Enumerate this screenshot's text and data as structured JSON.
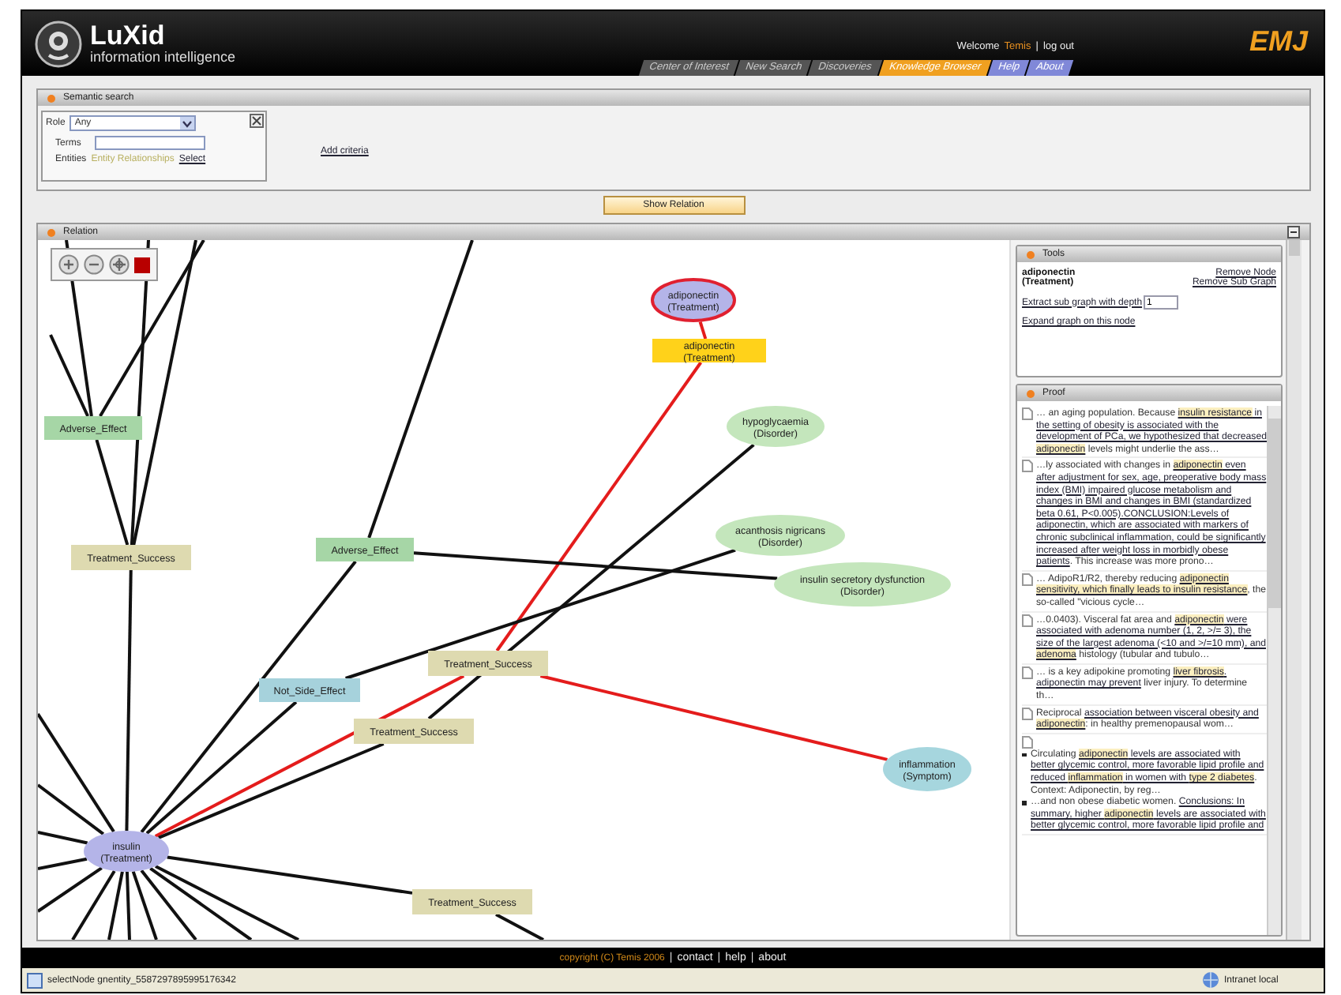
{
  "header": {
    "logo_name": "LuXid",
    "logo_tagline": "information intelligence",
    "welcome": "Welcome",
    "user": "Temis",
    "separator": "|",
    "logout": "log out",
    "brand": "EMJ"
  },
  "tabs": [
    {
      "label": "Center of Interest",
      "kind": "section",
      "selected": false
    },
    {
      "label": "New Search",
      "kind": "section",
      "selected": false
    },
    {
      "label": "Discoveries",
      "kind": "section",
      "selected": false
    },
    {
      "label": "Knowledge Browser",
      "kind": "section",
      "selected": true
    },
    {
      "label": "Help",
      "kind": "info",
      "selected": false
    },
    {
      "label": "About",
      "kind": "info",
      "selected": false
    }
  ],
  "semantic_search": {
    "title": "Semantic search",
    "role_label": "Role",
    "role_value": "Any",
    "terms_label": "Terms",
    "entities_label": "Entities",
    "entities_value": "Entity Relationships",
    "select_link": "Select",
    "add_criteria": "Add criteria"
  },
  "show_relation_button": "Show Relation",
  "relation": {
    "title": "Relation",
    "nodes": [
      {
        "kind": "entity",
        "lines": [
          "adiponectin",
          "(Treatment)"
        ],
        "color": "#b4b4e8",
        "selected": true
      },
      {
        "kind": "label",
        "lines": [
          "adiponectin",
          "(Treatment)"
        ],
        "color": "#ffd21a",
        "selected": false
      },
      {
        "kind": "relation",
        "lines": [
          "Adverse_Effect"
        ],
        "color": "#a6d6a6",
        "selected": false
      },
      {
        "kind": "entity",
        "lines": [
          "hypoglycaemia",
          "(Disorder)"
        ],
        "color": "#c4e6bc",
        "selected": false
      },
      {
        "kind": "entity",
        "lines": [
          "acanthosis nigricans",
          "(Disorder)"
        ],
        "color": "#c4e6bc",
        "selected": false
      },
      {
        "kind": "relation",
        "lines": [
          "Treatment_Success"
        ],
        "color": "#dedab0",
        "selected": false
      },
      {
        "kind": "relation",
        "lines": [
          "Adverse_Effect"
        ],
        "color": "#a6d6a6",
        "selected": false
      },
      {
        "kind": "entity",
        "lines": [
          "insulin secretory dysfunction",
          "(Disorder)"
        ],
        "color": "#c4e6bc",
        "selected": false
      },
      {
        "kind": "relation",
        "lines": [
          "Treatment_Success"
        ],
        "color": "#dedab0",
        "selected": false
      },
      {
        "kind": "relation",
        "lines": [
          "Not_Side_Effect"
        ],
        "color": "#a6d2dc",
        "selected": false
      },
      {
        "kind": "relation",
        "lines": [
          "Treatment_Success"
        ],
        "color": "#dedab0",
        "selected": false
      },
      {
        "kind": "entity",
        "lines": [
          "inflammation",
          "(Symptom)"
        ],
        "color": "#a6d6de",
        "selected": false
      },
      {
        "kind": "entity",
        "lines": [
          "insulin",
          "(Treatment)"
        ],
        "color": "#b4b4e8",
        "selected": false
      },
      {
        "kind": "relation",
        "lines": [
          "Treatment_Success"
        ],
        "color": "#dedab0",
        "selected": false
      }
    ],
    "edges": [
      {
        "highlighted": true
      },
      {
        "highlighted": true
      },
      {
        "highlighted": true
      },
      {
        "highlighted": true
      },
      {
        "highlighted": false
      },
      {
        "highlighted": false
      },
      {
        "highlighted": false
      },
      {
        "highlighted": false
      },
      {
        "highlighted": false
      },
      {
        "highlighted": false
      },
      {
        "highlighted": false
      },
      {
        "highlighted": false
      },
      {
        "highlighted": false
      }
    ]
  },
  "tools": {
    "title": "Tools",
    "node_name": "adiponectin",
    "node_type": "(Treatment)",
    "remove_node": "Remove Node",
    "remove_sub_graph": "Remove Sub Graph",
    "extract_label": "Extract sub graph with depth",
    "depth": "1",
    "expand": "Expand graph on this node"
  },
  "proof": {
    "title": "Proof",
    "snippets": [
      {
        "kind": "inline",
        "paragraphs": [
          [
            {
              "text": "… an aging population. Because ",
              "kind": "plain"
            },
            {
              "text": "insulin resistance",
              "kind": "term"
            },
            {
              "text": " in the setting of obesity is associated with the development of PCa, we hypothesized that decreased ",
              "kind": "link"
            },
            {
              "text": "adiponectin",
              "kind": "term"
            },
            {
              "text": " levels might underlie the ass…",
              "kind": "plain"
            }
          ]
        ]
      },
      {
        "kind": "inline",
        "paragraphs": [
          [
            {
              "text": "…ly associated with changes in ",
              "kind": "plain"
            },
            {
              "text": "adiponectin",
              "kind": "term"
            },
            {
              "text": " even after adjustment for sex, age, preoperative body mass index (BMI) impaired glucose metabolism and changes in BMI and changes in BMI (standardized beta 0.61, P<0.005).CONCLUSION:Levels of adiponectin, which are associated with markers of chronic subclinical inflammation, could be significantly increased after weight loss in morbidly obese patients",
              "kind": "link"
            },
            {
              "text": ". This increase was more prono…",
              "kind": "plain"
            }
          ]
        ]
      },
      {
        "kind": "inline",
        "paragraphs": [
          [
            {
              "text": "… AdipoR1/R2, thereby reducing ",
              "kind": "plain"
            },
            {
              "text": "adiponectin sensitivity, which finally leads to insulin resistance",
              "kind": "term"
            },
            {
              "text": ", the so-called \"vicious cycle…",
              "kind": "plain"
            }
          ]
        ]
      },
      {
        "kind": "inline",
        "paragraphs": [
          [
            {
              "text": "…0.0403). Visceral fat area and ",
              "kind": "plain"
            },
            {
              "text": "adiponectin",
              "kind": "term"
            },
            {
              "text": " were associated with adenoma number (1, 2, >/= 3), the size of the largest adenoma (<10 and >/=10 mm), and ",
              "kind": "link"
            },
            {
              "text": "adenoma",
              "kind": "term"
            },
            {
              "text": " histology (tubular and tubulo…",
              "kind": "plain"
            }
          ]
        ]
      },
      {
        "kind": "inline",
        "paragraphs": [
          [
            {
              "text": "… is a key adipokine promoting ",
              "kind": "plain"
            },
            {
              "text": "liver fibrosis",
              "kind": "term"
            },
            {
              "text": ". adiponectin may prevent",
              "kind": "link"
            },
            {
              "text": " liver injury. To determine th…",
              "kind": "plain"
            }
          ]
        ]
      },
      {
        "kind": "inline",
        "paragraphs": [
          [
            {
              "text": "Reciprocal ",
              "kind": "plain"
            },
            {
              "text": "association between visceral obesity and ",
              "kind": "link"
            },
            {
              "text": "adiponectin",
              "kind": "term"
            },
            {
              "text": ": in healthy premenopausal wom…",
              "kind": "plain"
            }
          ]
        ]
      },
      {
        "kind": "list",
        "paragraphs": [
          [
            {
              "text": "Circulating ",
              "kind": "plain"
            },
            {
              "text": "adiponectin",
              "kind": "term"
            },
            {
              "text": " levels are associated with better glycemic control, more favorable lipid profile and reduced ",
              "kind": "link"
            },
            {
              "text": "inflammation",
              "kind": "term"
            },
            {
              "text": " in women with ",
              "kind": "link"
            },
            {
              "text": "type 2 diabetes",
              "kind": "term"
            },
            {
              "text": ". Context: Adiponectin, by reg…",
              "kind": "plain"
            }
          ],
          [
            {
              "text": "…and non obese diabetic women. ",
              "kind": "plain"
            },
            {
              "text": "Conclusions: In summary, higher ",
              "kind": "link"
            },
            {
              "text": "adiponectin",
              "kind": "term"
            },
            {
              "text": " levels are associated with better glycemic control, more favorable lipid profile and",
              "kind": "link"
            }
          ]
        ]
      }
    ]
  },
  "footer": {
    "copyright": "copyright (C) Temis 2006",
    "links": [
      "contact",
      "help",
      "about"
    ],
    "separator": "|"
  },
  "status_bar": {
    "message": "selectNode gnentity_5587297895995176342",
    "zone": "Intranet local"
  }
}
